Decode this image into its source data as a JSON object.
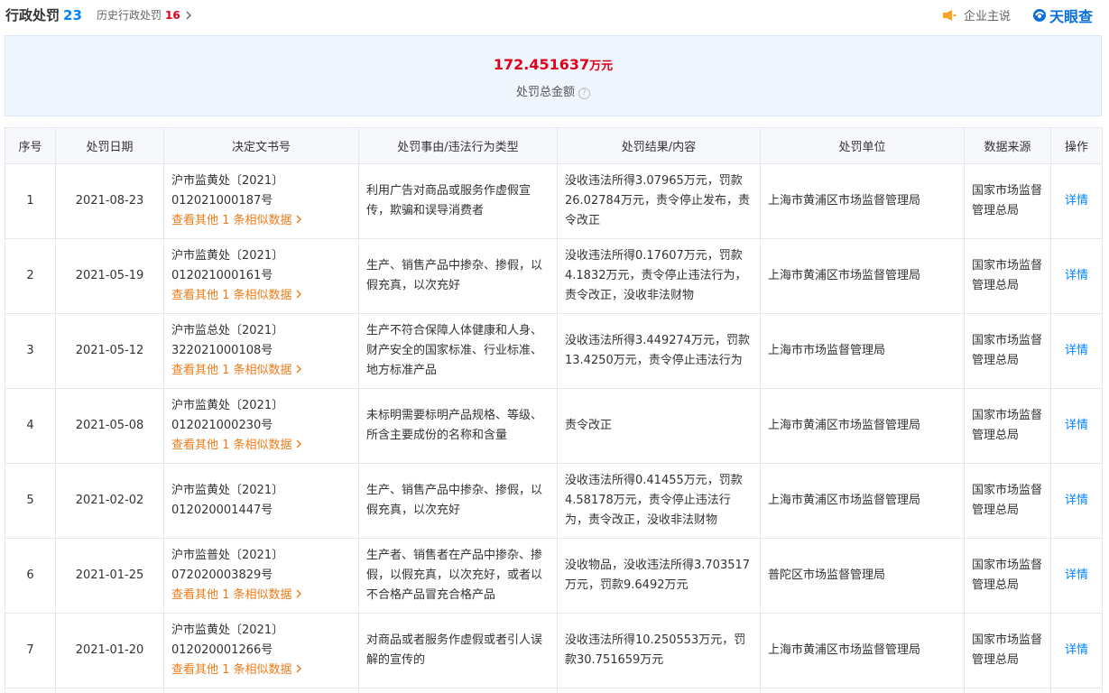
{
  "header": {
    "title": "行政处罚",
    "count": "23",
    "history_label": "历史行政处罚",
    "history_count": "16",
    "history_chevron": "chevron-right-icon",
    "owner_label": "企业主说",
    "owner_icon": "speaker-icon",
    "brand": "天眼查",
    "brand_icon": "tianyancha-logo-icon"
  },
  "summary": {
    "amount": "172.451637",
    "unit": "万元",
    "label": "处罚总金额",
    "help_icon": "question-circle-icon",
    "help_glyph": "?"
  },
  "table": {
    "headers": [
      "序号",
      "处罚日期",
      "决定文书号",
      "处罚事由/违法行为类型",
      "处罚结果/内容",
      "处罚单位",
      "数据来源",
      "操作"
    ],
    "rows": [
      {
        "no": "1",
        "date": "2021-08-23",
        "doc": "沪市监黄处〔2021〕012021000187号",
        "similar": "查看其他 1 条相似数据",
        "reason": "利用广告对商品或服务作虚假宣传，欺骗和误导消费者",
        "result": "没收违法所得3.07965万元，罚款26.02784万元，责令停止发布，责令改正",
        "unit": "上海市黄浦区市场监督管理局",
        "source": "国家市场监督管理总局",
        "action": "详情"
      },
      {
        "no": "2",
        "date": "2021-05-19",
        "doc": "沪市监黄处〔2021〕012021000161号",
        "similar": "查看其他 1 条相似数据",
        "reason": "生产、销售产品中掺杂、掺假，以假充真，以次充好",
        "result": "没收违法所得0.17607万元，罚款4.1832万元，责令停止违法行为，责令改正，没收非法财物",
        "unit": "上海市黄浦区市场监督管理局",
        "source": "国家市场监督管理总局",
        "action": "详情"
      },
      {
        "no": "3",
        "date": "2021-05-12",
        "doc": "沪市监总处〔2021〕322021000108号",
        "similar": "查看其他 1 条相似数据",
        "reason": "生产不符合保障人体健康和人身、财产安全的国家标准、行业标准、地方标准产品",
        "result": "没收违法所得3.449274万元，罚款13.4250万元，责令停止违法行为",
        "unit": "上海市市场监督管理局",
        "source": "国家市场监督管理总局",
        "action": "详情"
      },
      {
        "no": "4",
        "date": "2021-05-08",
        "doc": "沪市监黄处〔2021〕012021000230号",
        "similar": "查看其他 1 条相似数据",
        "reason": "未标明需要标明产品规格、等级、所含主要成份的名称和含量",
        "result": "责令改正",
        "unit": "上海市黄浦区市场监督管理局",
        "source": "国家市场监督管理总局",
        "action": "详情"
      },
      {
        "no": "5",
        "date": "2021-02-02",
        "doc": "沪市监黄处〔2021〕012020001447号",
        "similar": "",
        "reason": "生产、销售产品中掺杂、掺假，以假充真，以次充好",
        "result": "没收违法所得0.41455万元，罚款4.58178万元，责令停止违法行为，责令改正，没收非法财物",
        "unit": "上海市黄浦区市场监督管理局",
        "source": "国家市场监督管理总局",
        "action": "详情"
      },
      {
        "no": "6",
        "date": "2021-01-25",
        "doc": "沪市监普处〔2021〕072020003829号",
        "similar": "查看其他 1 条相似数据",
        "reason": "生产者、销售者在产品中掺杂、掺假，以假充真，以次充好，或者以不合格产品冒充合格产品",
        "result": "没收物品，没收违法所得3.703517万元，罚款9.6492万元",
        "unit": "普陀区市场监督管理局",
        "source": "国家市场监督管理总局",
        "action": "详情"
      },
      {
        "no": "7",
        "date": "2021-01-20",
        "doc": "沪市监黄处〔2021〕012020001266号",
        "similar": "查看其他 1 条相似数据",
        "reason": "对商品或者服务作虚假或者引人误解的宣传的",
        "result": "没收违法所得10.250553万元，罚款30.751659万元",
        "unit": "上海市黄浦区市场监督管理局",
        "source": "国家市场监督管理总局",
        "action": "详情"
      }
    ]
  },
  "colors": {
    "accent_blue": "#0084ff",
    "amount_red": "#e0001a",
    "similar_orange": "#f07b18",
    "summary_bg": "#f0f6fd"
  }
}
